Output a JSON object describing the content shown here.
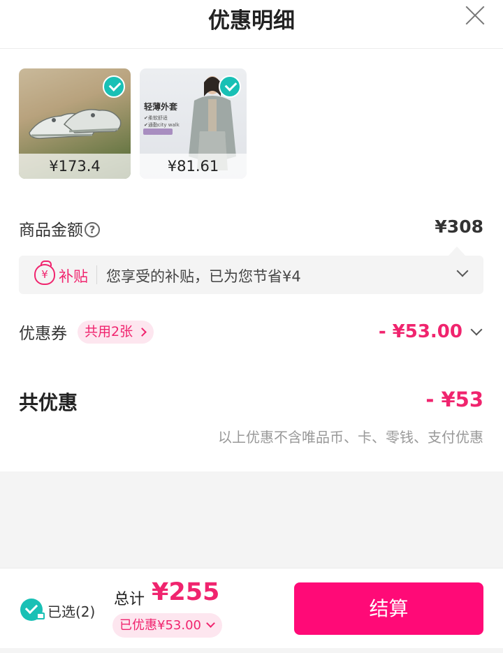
{
  "header": {
    "title": "优惠明细",
    "close_icon": "close-icon"
  },
  "products": [
    {
      "price": "¥173.4",
      "selected": true,
      "image": "sneaker"
    },
    {
      "price": "¥81.61",
      "selected": true,
      "image": "jacket",
      "promo": {
        "title": "轻薄外套",
        "line1": "✔柔软舒适",
        "line2": "✔通勤city walk"
      }
    }
  ],
  "amount": {
    "label": "商品金额",
    "value": "¥308",
    "help_icon": "question-icon"
  },
  "subsidy": {
    "tag": "补贴",
    "text": "您享受的补贴，已为您节省¥4",
    "icon_text": "¥"
  },
  "coupon": {
    "label": "优惠券",
    "chip": "共用2张",
    "value": "- ¥53.00"
  },
  "total_discount": {
    "label": "共优惠",
    "value": "- ¥53",
    "note": "以上优惠不含唯品币、卡、零钱、支付优惠"
  },
  "footer": {
    "selected": "已选(2)",
    "sum_label": "总计",
    "sum_value": "¥255",
    "saved": "已优惠¥53.00",
    "checkout": "结算"
  },
  "colors": {
    "accent": "#f0246e",
    "checkout_bg": "#ff0a77",
    "check": "#19c0b5"
  }
}
